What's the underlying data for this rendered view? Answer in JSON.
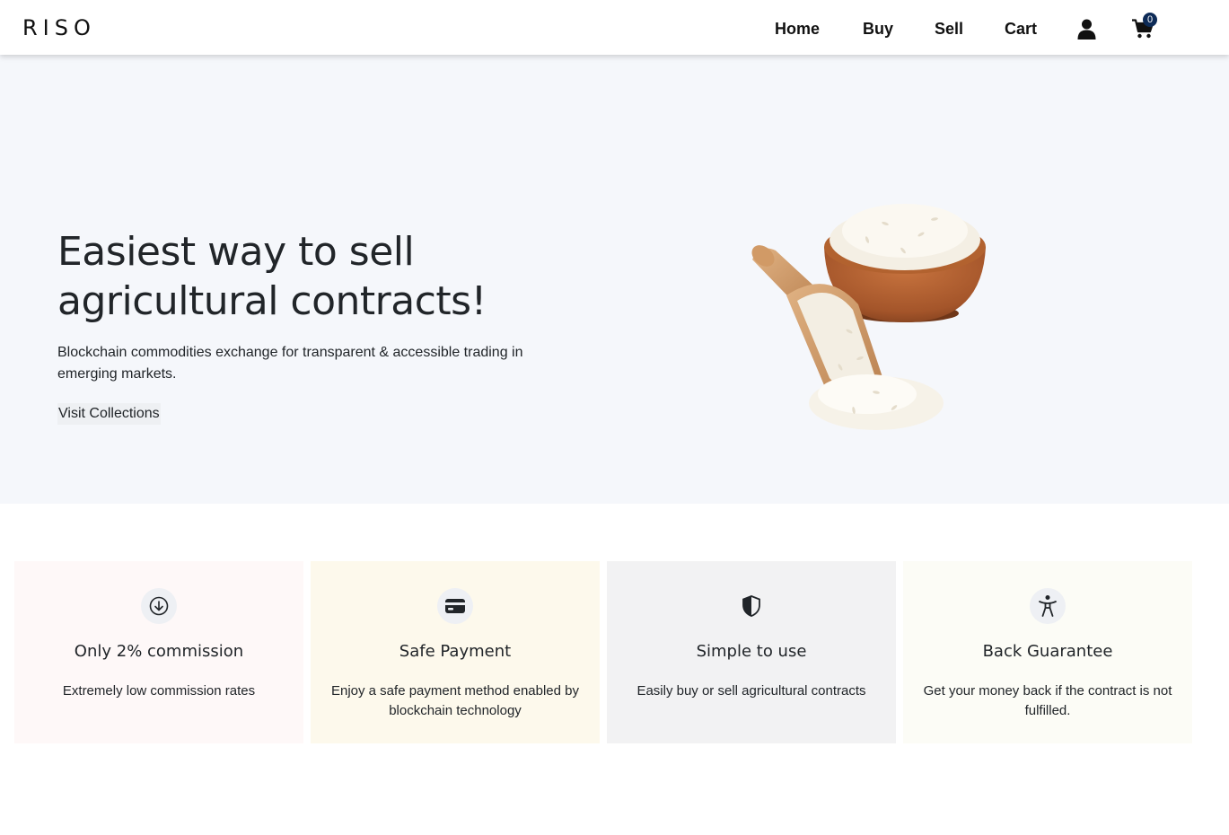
{
  "brand": "RISO",
  "nav": {
    "home": "Home",
    "buy": "Buy",
    "sell": "Sell",
    "cart": "Cart",
    "cart_count": "0",
    "user_icon": "user-icon",
    "cart_icon": "shopping-cart-icon"
  },
  "hero": {
    "title": "Easiest way to sell agricultural contracts!",
    "subtitle": "Blockchain commodities exchange for transparent & accessible trading in emerging markets.",
    "cta": "Visit Collections",
    "image": "rice-bowl-and-scoop"
  },
  "features": [
    {
      "icon": "arrow-down-circle-icon",
      "title": "Only 2% commission",
      "desc": "Extremely low commission rates",
      "bg": "#fef8f8"
    },
    {
      "icon": "credit-card-icon",
      "title": "Safe Payment",
      "desc": "Enjoy a safe payment method enabled by blockchain technology",
      "bg": "#fdf9ec"
    },
    {
      "icon": "shield-icon",
      "title": "Simple to use",
      "desc": "Easily buy or sell agricultural contracts",
      "bg": "#f2f2f3"
    },
    {
      "icon": "accessibility-icon",
      "title": "Back Guarantee",
      "desc": "Get your money back if the contract is not fulfilled.",
      "bg": "#fcfcf6"
    }
  ],
  "colors": {
    "hero_bg": "#f5f7fb",
    "badge": "#0d2b57"
  }
}
